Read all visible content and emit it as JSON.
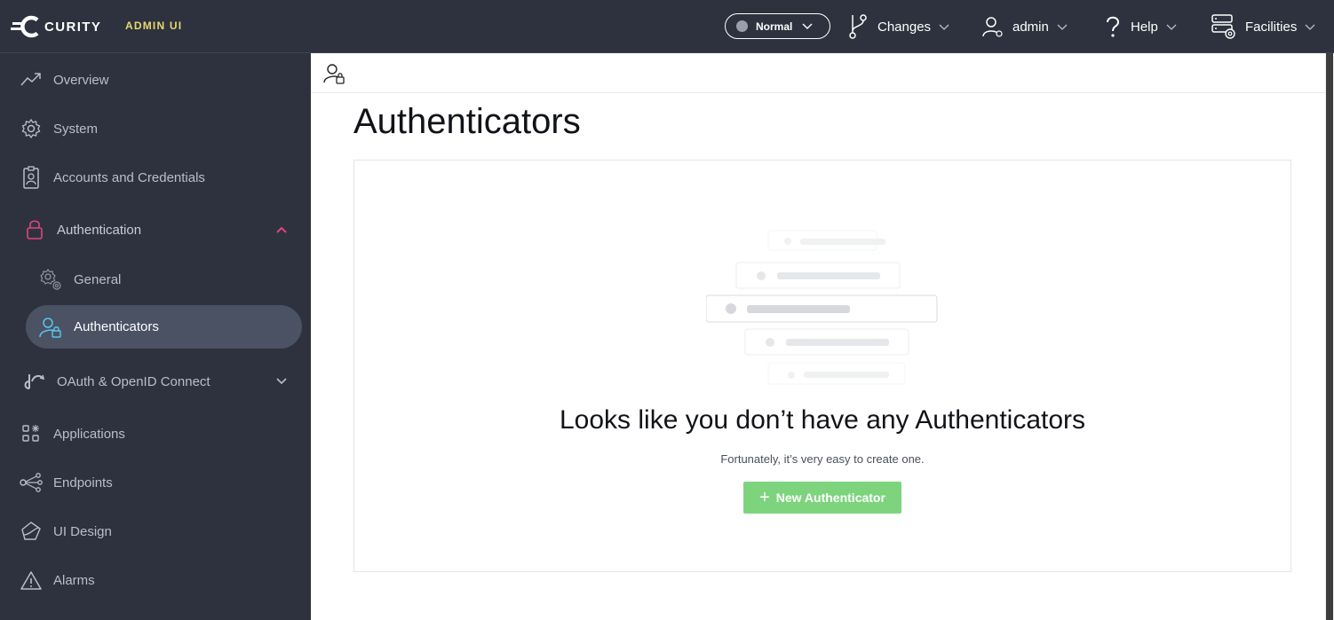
{
  "header": {
    "brand_name": "CURITY",
    "admin_ui": "ADMIN UI",
    "mode": "Normal",
    "changes": "Changes",
    "user": "admin",
    "help": "Help",
    "facilities": "Facilities"
  },
  "sidebar": {
    "items": [
      {
        "label": "Overview",
        "icon": "trend-icon"
      },
      {
        "label": "System",
        "icon": "gear-icon"
      },
      {
        "label": "Accounts and Credentials",
        "icon": "id-badge-icon"
      },
      {
        "label": "Authentication",
        "icon": "lock-icon",
        "expanded": true
      },
      {
        "label": "General",
        "icon": "gears-icon"
      },
      {
        "label": "Authenticators",
        "icon": "user-lock-icon",
        "active": true
      },
      {
        "label": "OAuth & OpenID Connect",
        "icon": "oauth-icon",
        "expanded": false
      },
      {
        "label": "Applications",
        "icon": "apps-icon"
      },
      {
        "label": "Endpoints",
        "icon": "endpoints-icon"
      },
      {
        "label": "UI Design",
        "icon": "design-icon"
      },
      {
        "label": "Alarms",
        "icon": "warning-icon"
      }
    ]
  },
  "main": {
    "title": "Authenticators",
    "empty_heading": "Looks like you don’t have any Authenticators",
    "empty_sub": "Fortunately, it’s very easy to create one.",
    "new_button": "New Authenticator"
  },
  "colors": {
    "topbar_bg": "#2d323e",
    "sidebar_bg": "#2d323e",
    "active_item_bg": "#4a5264",
    "accent_pink": "#e0457b",
    "accent_cyan": "#5bc8e8",
    "admin_ui_yellow": "#e8d870",
    "new_button_green": "#7dd47d"
  }
}
